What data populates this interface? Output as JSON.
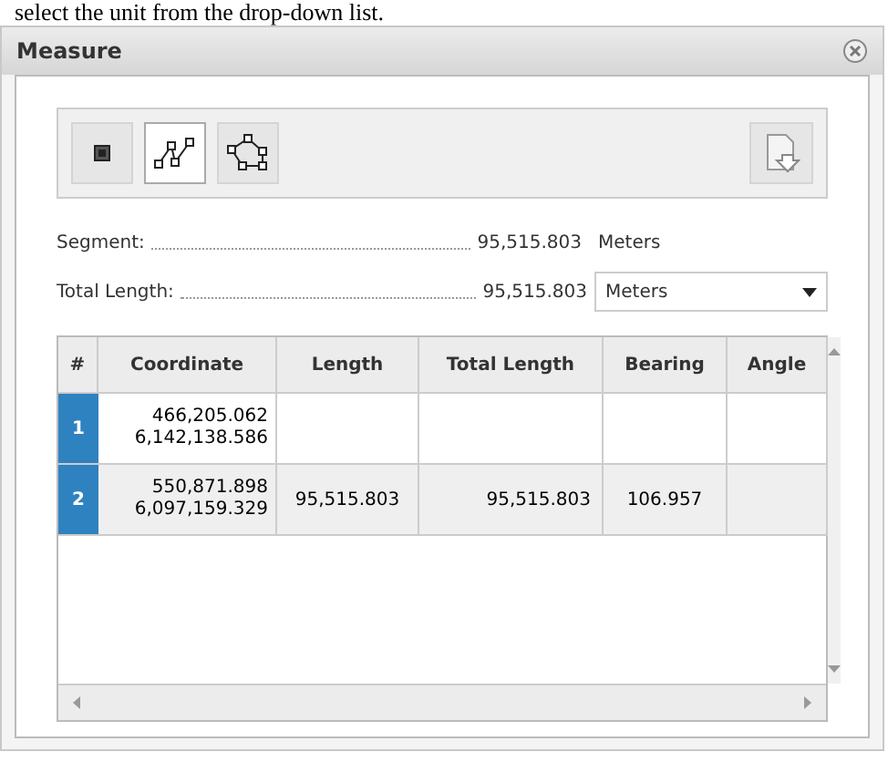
{
  "background_text": "select the unit from the drop-down list.",
  "window": {
    "title": "Measure"
  },
  "tools": [
    {
      "kind": "point",
      "selected": false
    },
    {
      "kind": "line",
      "selected": true
    },
    {
      "kind": "polygon",
      "selected": false
    }
  ],
  "segment": {
    "label": "Segment:",
    "value": "95,515.803",
    "unit": "Meters"
  },
  "total_length": {
    "label": "Total Length:",
    "value": "95,515.803",
    "unit": "Meters"
  },
  "table": {
    "columns": [
      "#",
      "Coordinate",
      "Length",
      "Total Length",
      "Bearing",
      "Angle"
    ],
    "rows": [
      {
        "number": "1",
        "coordinate": [
          "466,205.062",
          "6,142,138.586"
        ],
        "length": "",
        "total_length": "",
        "bearing": "",
        "selected": false
      },
      {
        "number": "2",
        "coordinate": [
          "550,871.898",
          "6,097,159.329"
        ],
        "length": "95,515.803",
        "total_length": "95,515.803",
        "bearing": "106.957",
        "selected": true
      }
    ]
  }
}
